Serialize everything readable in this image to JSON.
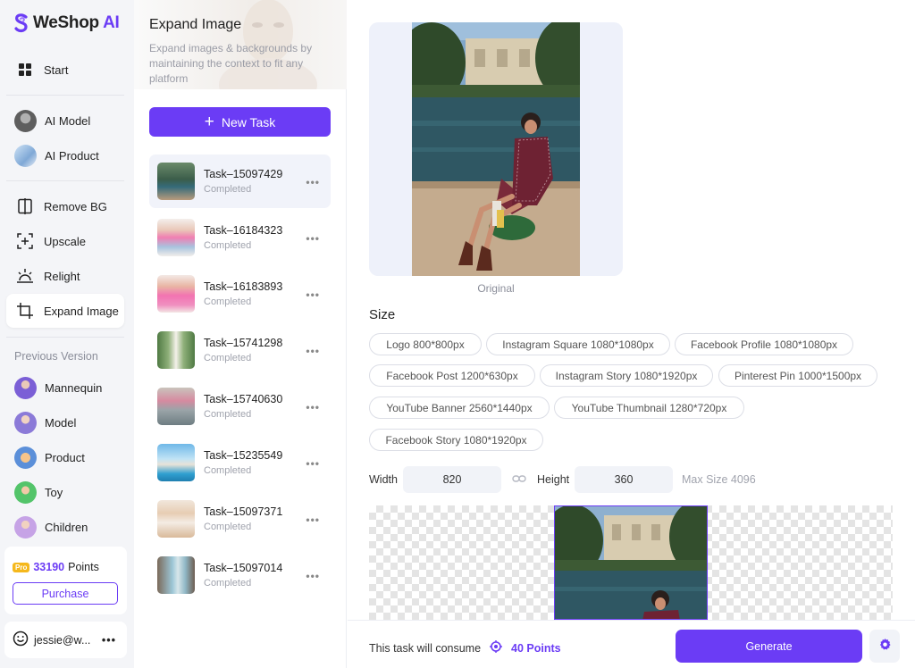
{
  "brand": {
    "name_main": "WeShop",
    "name_ai": " AI"
  },
  "nav": {
    "start": "Start",
    "ai_model": "AI Model",
    "ai_product": "AI Product",
    "remove_bg": "Remove BG",
    "upscale": "Upscale",
    "relight": "Relight",
    "expand_image": "Expand Image",
    "previous_version": "Previous Version",
    "mannequin": "Mannequin",
    "model": "Model",
    "product": "Product",
    "toy": "Toy",
    "children": "Children"
  },
  "account": {
    "badge": "Pro",
    "points_value": "33190",
    "points_unit": "Points",
    "purchase": "Purchase",
    "user": "jessie@w..."
  },
  "tasks_panel": {
    "title": "Expand Image",
    "subtitle": "Expand images & backgrounds by maintaining the context to fit any platform",
    "new_task": "New Task",
    "items": [
      {
        "name": "Task–15097429",
        "status": "Completed"
      },
      {
        "name": "Task–16184323",
        "status": "Completed"
      },
      {
        "name": "Task–16183893",
        "status": "Completed"
      },
      {
        "name": "Task–15741298",
        "status": "Completed"
      },
      {
        "name": "Task–15740630",
        "status": "Completed"
      },
      {
        "name": "Task–15235549",
        "status": "Completed"
      },
      {
        "name": "Task–15097371",
        "status": "Completed"
      },
      {
        "name": "Task–15097014",
        "status": "Completed"
      }
    ]
  },
  "main": {
    "original_label": "Original",
    "size_title": "Size",
    "presets": [
      "Logo 800*800px",
      "Instagram Square 1080*1080px",
      "Facebook Profile 1080*1080px",
      "Facebook Post 1200*630px",
      "Instagram Story 1080*1920px",
      "Pinterest Pin 1000*1500px",
      "YouTube Banner 2560*1440px",
      "YouTube Thumbnail 1280*720px",
      "Facebook Story 1080*1920px"
    ],
    "width_label": "Width",
    "width_value": "820",
    "height_label": "Height",
    "height_value": "360",
    "max_size": "Max Size 4096",
    "consume_label": "This task will consume",
    "consume_points": "40 Points",
    "generate": "Generate"
  },
  "colors": {
    "accent": "#6b3cf5",
    "nav_bg": "#f4f5f8"
  }
}
